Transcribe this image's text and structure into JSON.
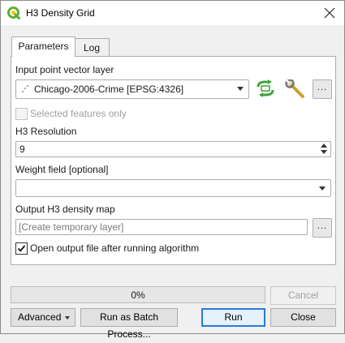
{
  "window": {
    "title": "H3 Density Grid"
  },
  "tabs": [
    {
      "label": "Parameters"
    },
    {
      "label": "Log"
    }
  ],
  "params": {
    "input_label": "Input point vector layer",
    "input_value": "Chicago-2006-Crime [EPSG:4326]",
    "selected_only_label": "Selected features only",
    "resolution_label": "H3 Resolution",
    "resolution_value": "9",
    "weight_label": "Weight field [optional]",
    "weight_value": "",
    "output_label": "Output H3 density map",
    "output_placeholder": "[Create temporary layer]",
    "open_output_label": "Open output file after running algorithm",
    "ellipsis": "..."
  },
  "progress": {
    "text": "0%",
    "value": 0
  },
  "buttons": {
    "cancel": "Cancel",
    "advanced": "Advanced",
    "batch": "Run as Batch Process...",
    "run": "Run",
    "close": "Close"
  },
  "colors": {
    "qgis_green": "#5bb030",
    "iterate_green": "#3fa33a",
    "focus_blue": "#2a7ad4"
  }
}
